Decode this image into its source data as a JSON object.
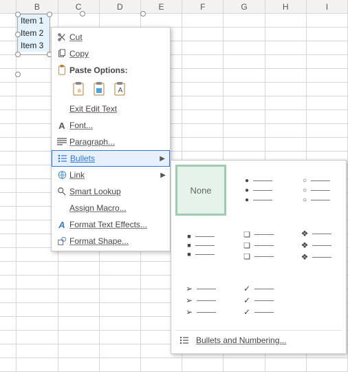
{
  "columns": [
    "B",
    "C",
    "D",
    "E",
    "F",
    "G",
    "H",
    "I"
  ],
  "textbox": {
    "items": [
      "Item 1",
      "Item 2",
      "Item 3"
    ]
  },
  "menu": {
    "cut": "Cut",
    "copy": "Copy",
    "paste_label": "Paste Options:",
    "exit_edit": "Exit Edit Text",
    "font": "Font...",
    "paragraph": "Paragraph...",
    "bullets": "Bullets",
    "link": "Link",
    "smart_lookup": "Smart Lookup",
    "assign_macro": "Assign Macro...",
    "format_text_effects": "Format Text Effects...",
    "format_shape": "Format Shape..."
  },
  "submenu": {
    "none": "None",
    "footer": "Bullets and Numbering..."
  }
}
